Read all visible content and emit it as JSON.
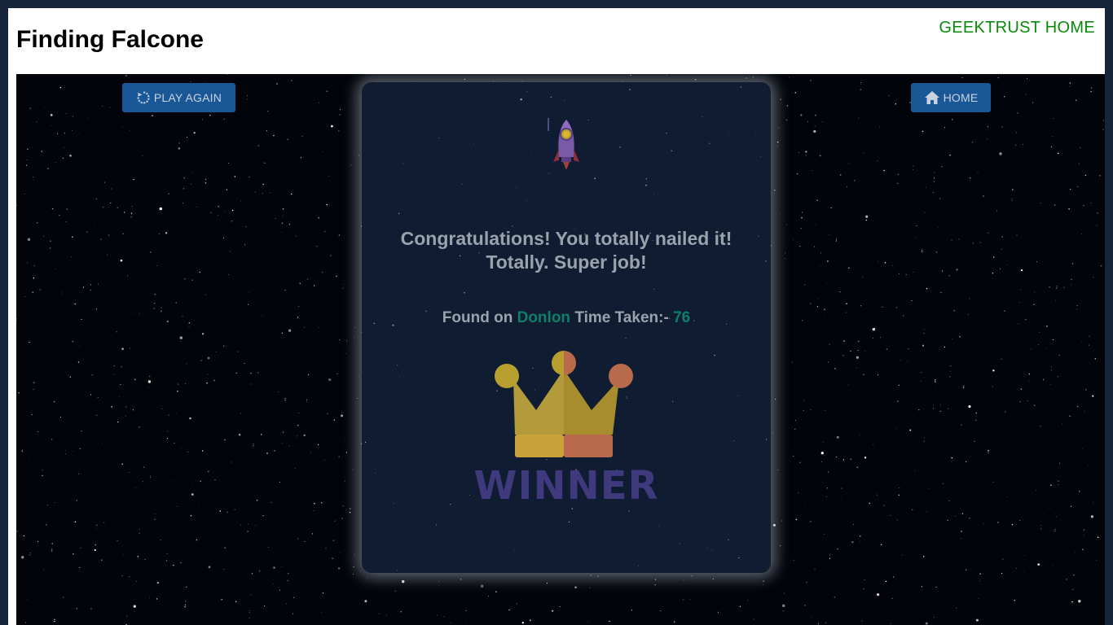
{
  "header": {
    "title": "Finding Falcone",
    "home_link": "GEEKTRUST HOME"
  },
  "actions": {
    "play_again": "PLAY AGAIN",
    "home": "HOME"
  },
  "result": {
    "line1": "Congratulations! You totally nailed it!",
    "line2": "Totally. Super job!",
    "found_prefix": "Found on",
    "planet": "Donlon",
    "time_prefix": "Time Taken:-",
    "time": "76",
    "badge": "WINNER"
  },
  "colors": {
    "accent_green": "#0a8a0a",
    "button_blue": "#1a5796",
    "highlight_teal": "#0f7e6a"
  },
  "icons": [
    "refresh-icon",
    "house-icon",
    "rocket-icon",
    "crown-icon"
  ]
}
